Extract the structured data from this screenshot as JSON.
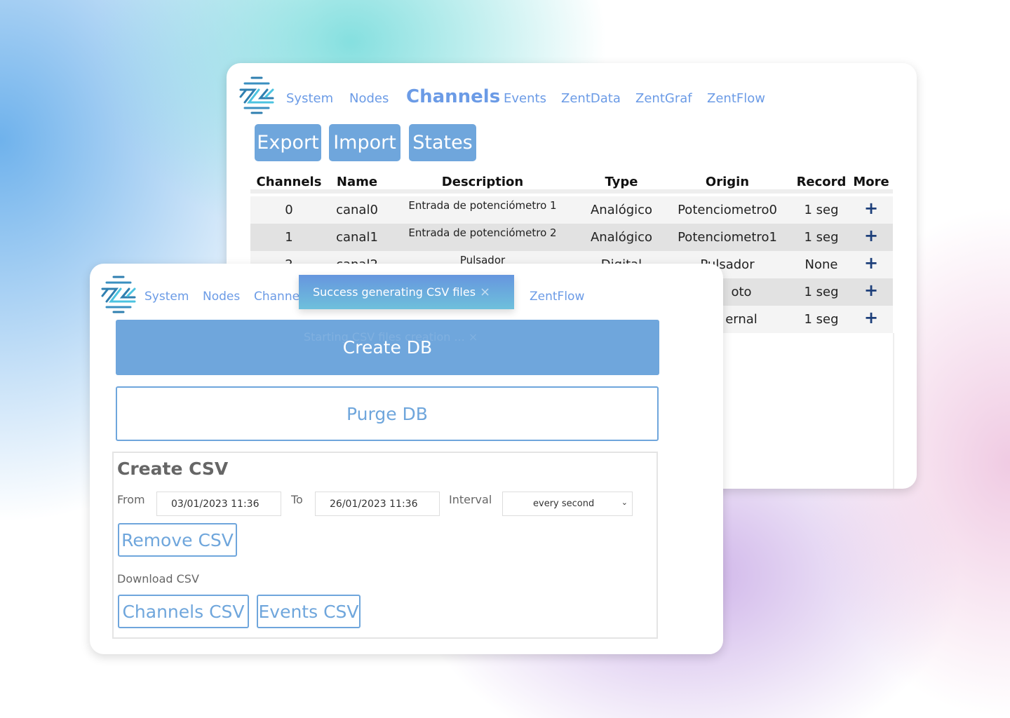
{
  "back": {
    "nav": [
      "System",
      "Nodes",
      "Channels",
      "Events",
      "ZentData",
      "ZentGraf",
      "ZentFlow"
    ],
    "buttons": [
      "Export",
      "Import",
      "States"
    ],
    "headers": [
      "Channels",
      "Name",
      "Description",
      "Type",
      "Origin",
      "Record",
      "More"
    ],
    "rows": [
      [
        "0",
        "canal0",
        "Entrada de potenciómetro 1",
        "Analógico",
        "Potenciometro0",
        "1 seg",
        "+"
      ],
      [
        "1",
        "canal1",
        "Entrada de potenciómetro 2",
        "Analógico",
        "Potenciometro1",
        "1 seg",
        "+"
      ],
      [
        "2",
        "canal2",
        "Pulsador",
        "Digital",
        "Pulsador",
        "None",
        "+"
      ],
      [
        "",
        "",
        "",
        "",
        "oto",
        "1 seg",
        "+"
      ],
      [
        "",
        "",
        "",
        "",
        "ernal",
        "1 seg",
        "+"
      ]
    ]
  },
  "front": {
    "nav": [
      "System",
      "Nodes",
      "Channels",
      "ZentFlow"
    ],
    "toast": "Success generating CSV files",
    "toast_faded": "Starting CSV files creation ...",
    "create_db": "Create DB",
    "purge_db": "Purge DB",
    "csv": {
      "title": "Create CSV",
      "from_label": "From",
      "from": "03/01/2023 11:36",
      "to_label": "To",
      "to": "26/01/2023 11:36",
      "interval_label": "Interval",
      "interval": "every second",
      "remove": "Remove CSV",
      "download_label": "Download CSV",
      "channels_csv": "Channels CSV",
      "events_csv": "Events CSV"
    }
  },
  "colors": {
    "accent": "#6fa6dc",
    "nav": "#6b9be6",
    "plus": "#1d3f7a"
  }
}
